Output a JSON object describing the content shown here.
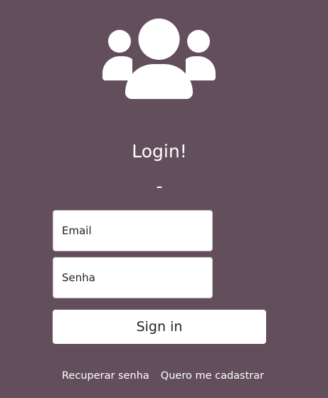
{
  "header": {
    "icon": "users-icon",
    "title": "Login!",
    "separator": "-"
  },
  "form": {
    "email_placeholder": "Email",
    "password_placeholder": "Senha",
    "submit_label": "Sign in"
  },
  "links": {
    "recover": "Recuperar senha",
    "register": "Quero me cadastrar"
  },
  "colors": {
    "background": "#634f5c",
    "foreground": "#ffffff"
  }
}
